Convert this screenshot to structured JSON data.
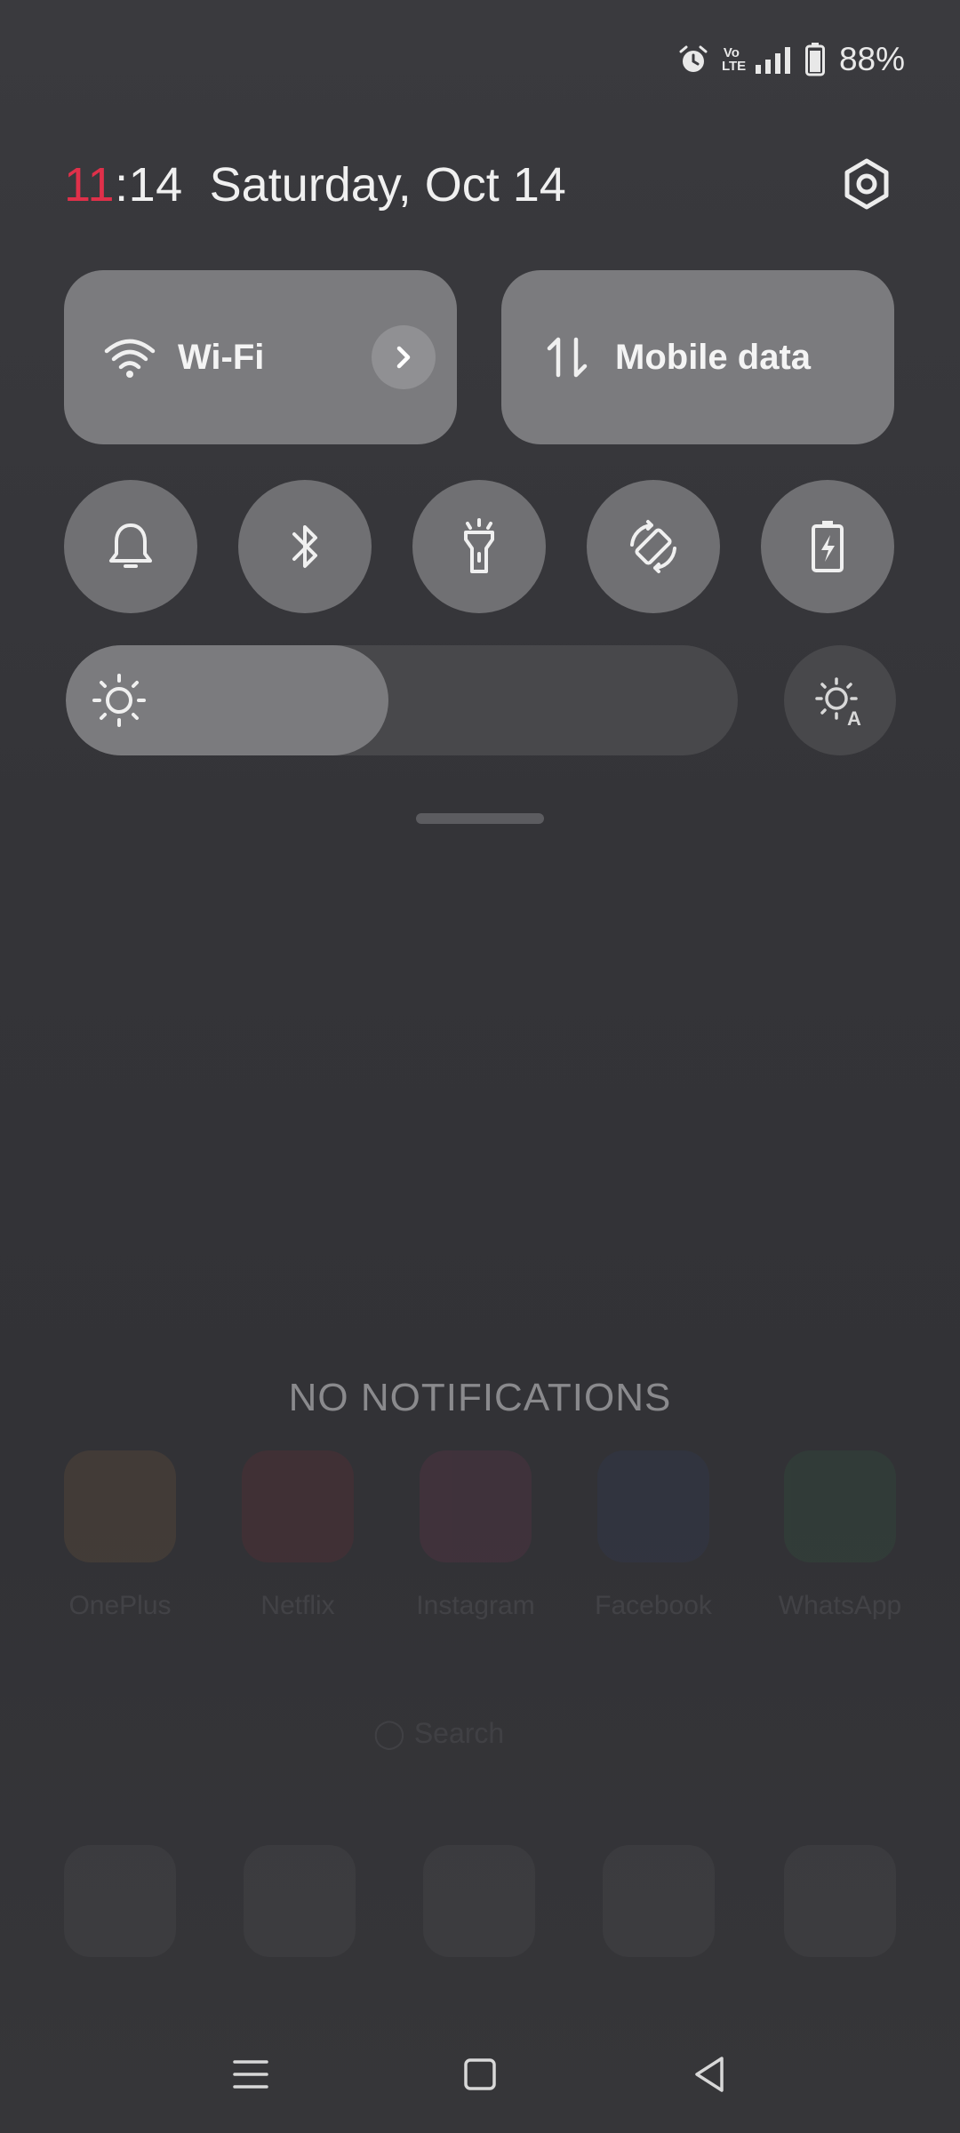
{
  "status_bar": {
    "icons": [
      "alarm-icon",
      "volte-icon",
      "cell-signal-icon",
      "battery-icon"
    ],
    "volte_text": "Vo LTE",
    "battery_percent": "88%"
  },
  "header": {
    "clock_hour": "11",
    "clock_rest": ":14",
    "date": "Saturday, Oct 14",
    "settings_icon": "gear-icon"
  },
  "tiles": {
    "wifi": {
      "label": "Wi-Fi",
      "icon": "wifi-icon",
      "arrow_icon": "chevron-right-icon"
    },
    "mobile_data": {
      "label": "Mobile data",
      "icon": "data-arrows-icon"
    }
  },
  "toggles": [
    {
      "name": "sound",
      "icon": "bell-icon"
    },
    {
      "name": "bluetooth",
      "icon": "bluetooth-icon"
    },
    {
      "name": "flashlight",
      "icon": "flashlight-icon"
    },
    {
      "name": "auto-rotate",
      "icon": "rotate-icon"
    },
    {
      "name": "battery-saver",
      "icon": "battery-saver-icon"
    }
  ],
  "brightness": {
    "level_percent": 48,
    "icon": "sun-icon",
    "auto_icon": "auto-brightness-icon"
  },
  "notifications": {
    "empty_text": "NO NOTIFICATIONS"
  },
  "background_home": {
    "apps": [
      "OnePlus",
      "Netflix",
      "Instagram",
      "Facebook",
      "WhatsApp"
    ],
    "search_label": "Search"
  },
  "colors": {
    "clock_hour": "#e0304a",
    "tile_bg": "#7b7b7e",
    "panel_bg": "#343438"
  }
}
